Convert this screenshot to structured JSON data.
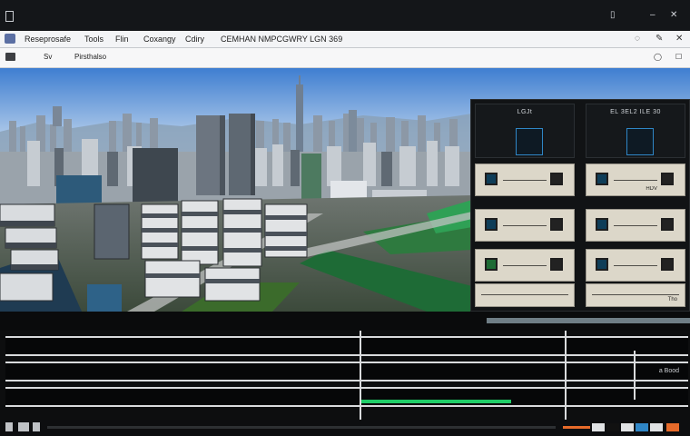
{
  "window": {
    "title": "",
    "controls": {
      "restore": "▯",
      "minimize": "–",
      "close": "✕"
    }
  },
  "menubar": {
    "items": [
      "Reseprosafe",
      "Tools",
      "Flin",
      "Coxangy",
      "Cdiry",
      "CEMHAN NMPCGWRY LGN 369"
    ],
    "right_controls": [
      "◌",
      "✎",
      "✕"
    ]
  },
  "toolbar": {
    "items": [
      {
        "icon": "camera-icon",
        "label": ""
      },
      {
        "icon": "",
        "label": "Sv"
      },
      {
        "icon": "",
        "label": "Pirsthalso"
      }
    ],
    "right_controls": [
      "◯",
      "☐"
    ]
  },
  "viewport": {
    "scene": "3D city model view"
  },
  "panel": {
    "columns": [
      {
        "header": "LGJt",
        "cards": [
          {
            "icon_left": "map-icon",
            "icon_right": "device-icon",
            "caption": ""
          },
          {
            "icon_left": "map-icon",
            "icon_right": "device-icon",
            "caption": ""
          },
          {
            "icon_left": "map-icon",
            "icon_right": "device-icon",
            "caption": ""
          }
        ],
        "footer": ""
      },
      {
        "header": "EL 3EL2 ILE 30",
        "cards": [
          {
            "icon_left": "map-icon",
            "icon_right": "device-icon",
            "caption": "HDV"
          },
          {
            "icon_left": "map-icon",
            "icon_right": "device-icon",
            "caption": ""
          },
          {
            "icon_left": "map-icon",
            "icon_right": "device-icon",
            "caption": ""
          }
        ],
        "footer": "Tho"
      }
    ]
  },
  "status": {
    "text": "",
    "progress": 0.0
  },
  "table": {
    "rows": [
      {
        "label": "",
        "right_label": "",
        "progress": 0.0
      },
      {
        "label": "",
        "right_label": "a Bood",
        "progress": 0.0
      },
      {
        "label": "",
        "right_label": "",
        "progress": 0.55
      }
    ]
  },
  "colors": {
    "accent_green": "#1fcc67",
    "accent_blue": "#2f86c6",
    "timeline_orange": "#e66a2a"
  }
}
